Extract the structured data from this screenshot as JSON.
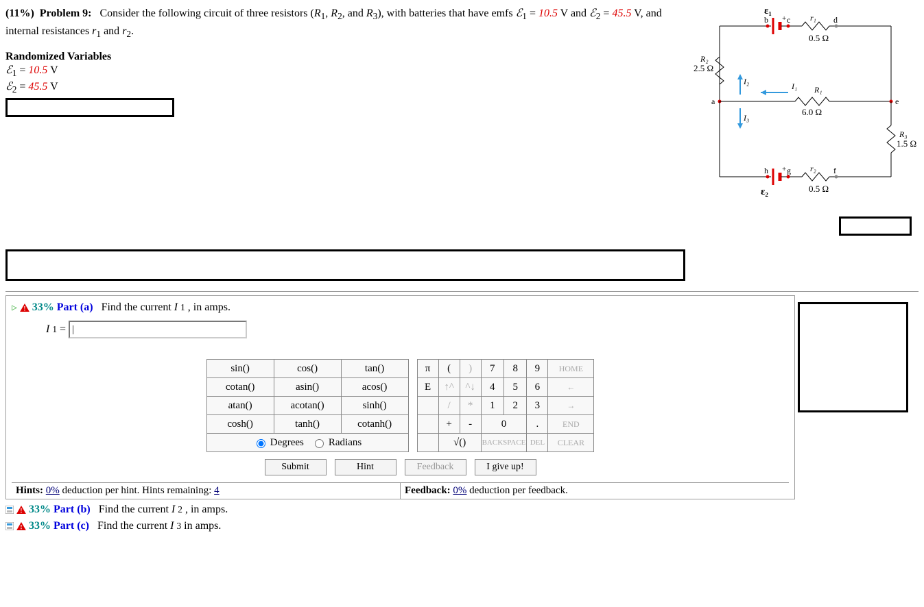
{
  "problem": {
    "percent": "(11%)",
    "label": "Problem 9:",
    "stem1": "Consider the following circuit of three resistors (",
    "R1": "R",
    "R1sub": "1",
    "comma1": ", ",
    "R2": "R",
    "R2sub": "2",
    "comma2": ", and ",
    "R3": "R",
    "R3sub": "3",
    "stem2": "), with batteries that have emfs ",
    "E1": "ℰ",
    "E1sub": "1",
    "eq1": " = ",
    "E1val": "10.5",
    "unitV1": " V and ",
    "E2": "ℰ",
    "E2sub": "2",
    "eq2": " = ",
    "E2val": "45.5",
    "unitV2": " V, and internal resistances ",
    "r1": "r",
    "r1sub": "1",
    "and": " and ",
    "r2": "r",
    "r2sub": "2",
    "period": "."
  },
  "randvars": {
    "heading": "Randomized Variables",
    "line1_sym": "ℰ",
    "line1_sub": "1",
    "line1_eq": " = ",
    "line1_val": "10.5",
    "line1_unit": " V",
    "line2_sym": "ℰ",
    "line2_sub": "2",
    "line2_eq": " = ",
    "line2_val": "45.5",
    "line2_unit": " V"
  },
  "circuit": {
    "E1": "ε₁",
    "E2": "ε₂",
    "r1": "r₁",
    "r2": "r₂",
    "R1": "R₁",
    "R2": "R₂",
    "R3": "R₃",
    "r1val": "0.5 Ω",
    "r2val": "0.5 Ω",
    "R1val": "6.0 Ω",
    "R2val": "2.5 Ω",
    "R3val": "1.5 Ω",
    "I1": "I₁",
    "I2": "I₂",
    "I3": "I₃",
    "a": "a",
    "b": "b",
    "c": "c",
    "d": "d",
    "e": "e",
    "f": "f",
    "g": "g",
    "h": "h"
  },
  "partA": {
    "percent": "33%",
    "label": "Part (a)",
    "prompt": "Find the current ",
    "I": "I",
    "Isub": "1",
    "rest": ", in amps.",
    "answer_prefix_I": "I",
    "answer_prefix_sub": "1",
    "answer_eq": " = "
  },
  "calc": {
    "fns": [
      [
        "sin()",
        "cos()",
        "tan()"
      ],
      [
        "cotan()",
        "asin()",
        "acos()"
      ],
      [
        "atan()",
        "acotan()",
        "sinh()"
      ],
      [
        "cosh()",
        "tanh()",
        "cotanh()"
      ]
    ],
    "mode_deg": "Degrees",
    "mode_rad": "Radians",
    "consts_row1": [
      "π",
      "(",
      ")"
    ],
    "consts_row2": [
      "E",
      "↑^",
      "^↓"
    ],
    "consts_row3": [
      "",
      "/",
      "*"
    ],
    "consts_row4": [
      "",
      "+",
      "-"
    ],
    "sqrt": "√()",
    "nums": [
      [
        "7",
        "8",
        "9"
      ],
      [
        "4",
        "5",
        "6"
      ],
      [
        "1",
        "2",
        "3"
      ]
    ],
    "zero": "0",
    "dot": ".",
    "nav": [
      "HOME",
      "←",
      "→",
      "END"
    ],
    "back": "BACKSPACE",
    "del": "DEL",
    "clear": "CLEAR"
  },
  "actions": {
    "submit": "Submit",
    "hint": "Hint",
    "feedback": "Feedback",
    "giveup": "I give up!"
  },
  "hints": {
    "label": "Hints: ",
    "ded": "0%",
    "rest": " deduction per hint. Hints remaining: ",
    "remaining": "4"
  },
  "feedback": {
    "label": "Feedback: ",
    "ded": "0%",
    "rest": " deduction per feedback."
  },
  "partB": {
    "percent": "33%",
    "label": "Part (b)",
    "prompt": "Find the current ",
    "I": "I",
    "Isub": "2",
    "rest": ", in amps."
  },
  "partC": {
    "percent": "33%",
    "label": "Part (c)",
    "prompt": "Find the current ",
    "I": "I",
    "Isub": "3",
    "rest": " in amps."
  }
}
